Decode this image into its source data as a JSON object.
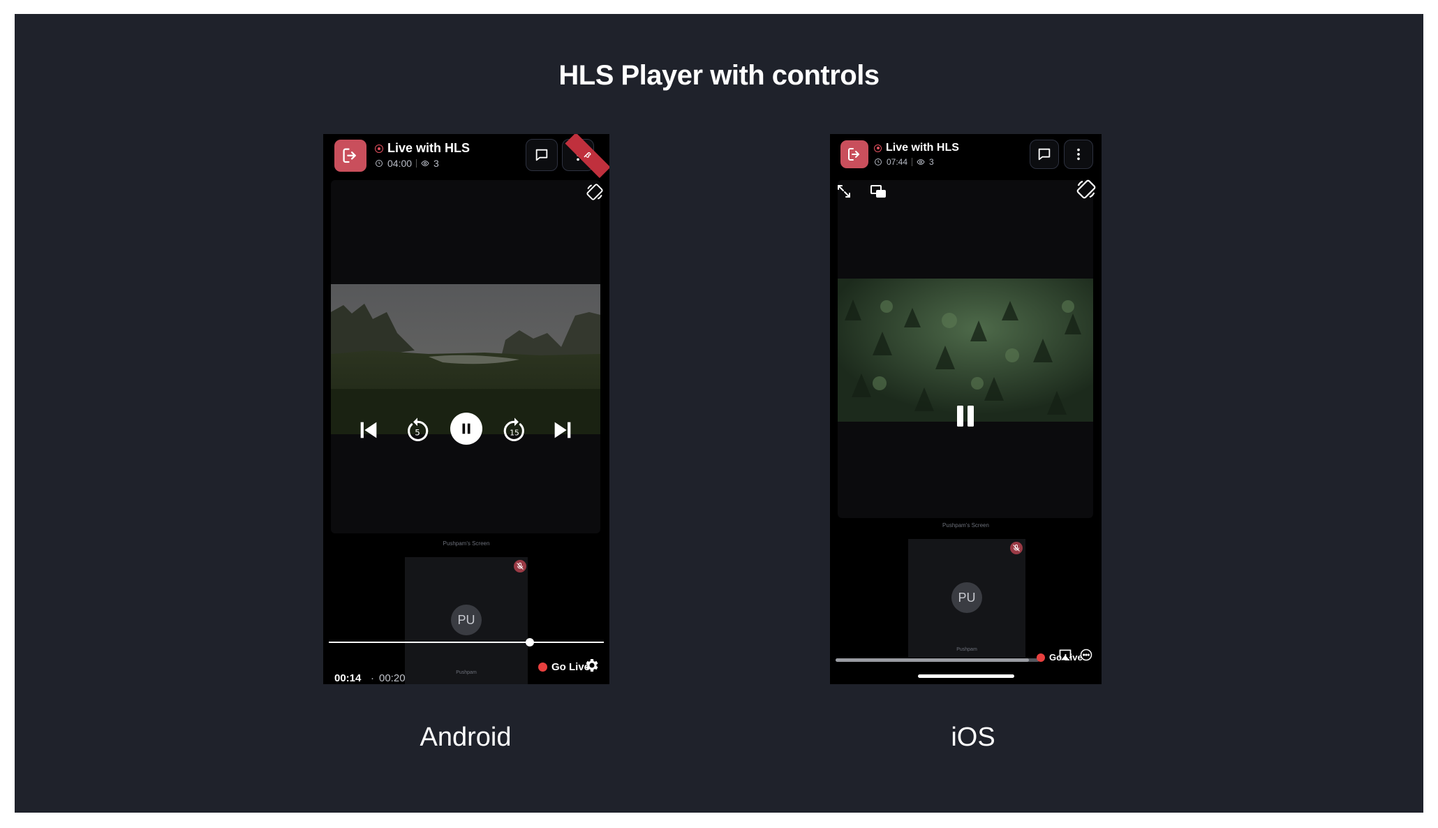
{
  "slide": {
    "title": "HLS Player with controls",
    "captions": {
      "android": "Android",
      "ios": "iOS"
    }
  },
  "android": {
    "room_name": "Live with HLS",
    "elapsed": "04:00",
    "viewers": "3",
    "ribbon": "β",
    "stage_label": "Pushpam's Screen",
    "avatar_initials": "PU",
    "tile_name": "Pushpam",
    "current_time": "00:14",
    "time_separator": "·",
    "duration": "00:20",
    "go_live": "Go Live",
    "seek_progress": 0.73,
    "rewind_seconds": "5",
    "forward_seconds": "15"
  },
  "ios": {
    "room_name": "Live with HLS",
    "elapsed": "07:44",
    "viewers": "3",
    "stage_label": "Pushpam's Screen",
    "avatar_initials": "PU",
    "tile_name": "Pushpam",
    "go_live": "Go Live",
    "seek_progress": 0.95
  },
  "colors": {
    "slide_bg": "#1f222b",
    "leave_button": "#c94f5c",
    "live_red": "#e8403f",
    "recording_ring": "#e2505f"
  },
  "icons": {
    "leave": "leave-icon",
    "chat": "chat-icon",
    "more": "more-vertical-icon",
    "rotate": "rotate-screen-icon",
    "expand": "expand-icon",
    "pip": "picture-in-picture-icon",
    "airplay": "airplay-icon",
    "settings": "gear-icon"
  }
}
